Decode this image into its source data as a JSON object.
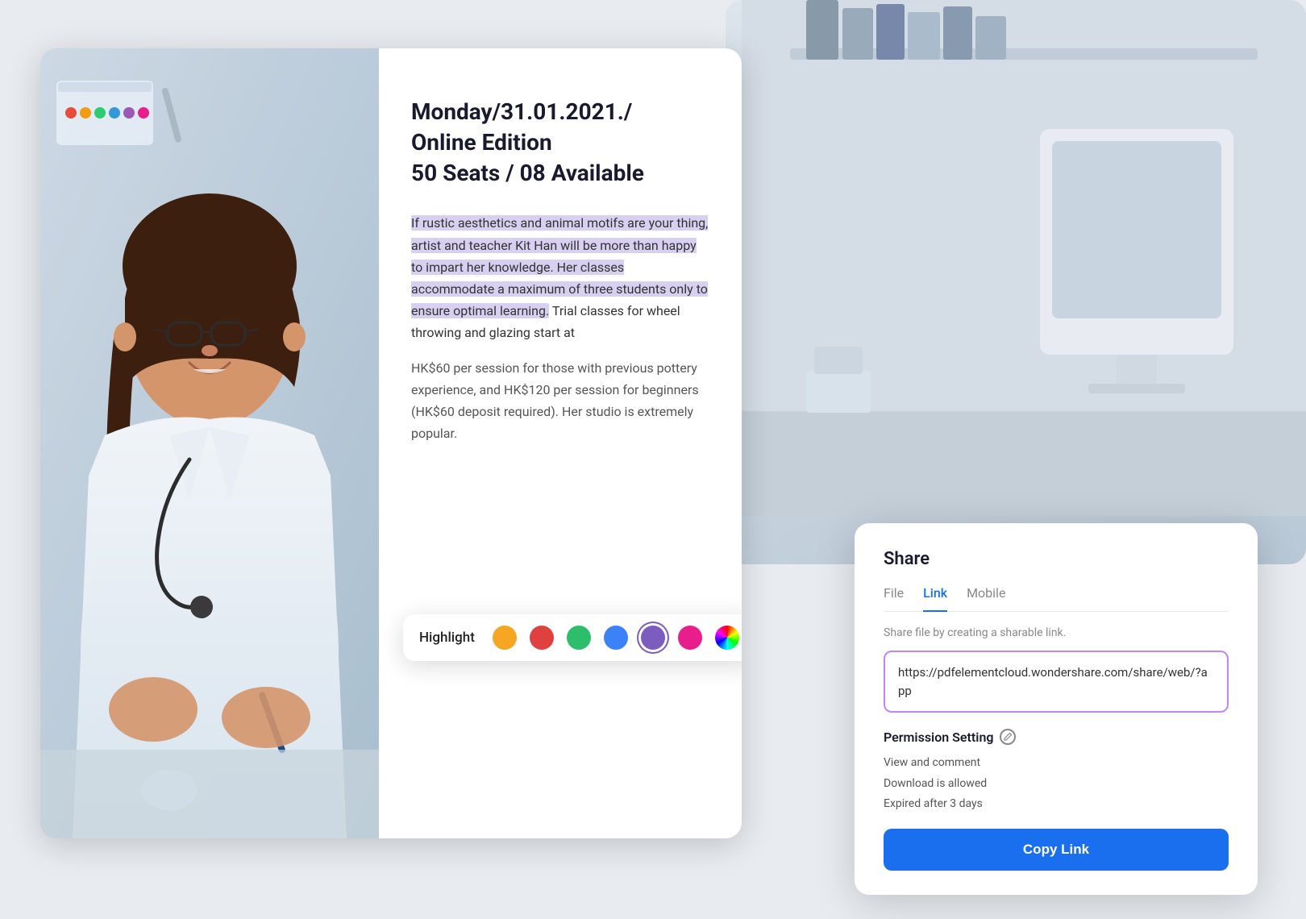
{
  "background": {
    "color": "#dce4ec"
  },
  "document": {
    "title": "Monday/31.01.2021./\nOnline Edition\n50 Seats / 08 Available",
    "body_highlighted": "If rustic aesthetics and animal motifs are your thing, artist and teacher Kit Han will be more than happy to impart her knowledge. Her classes accommodate a maximum of three students only to ensure optimal learning.",
    "body_normal": " Trial classes for wheel throwing and glazing start at",
    "price_lines": [
      "HK$60 per session for those with previous pottery",
      "experience, and HK$120 per session for beginners",
      "(HK$60 deposit required). Her studio is extremely",
      "popular."
    ]
  },
  "highlight_toolbar": {
    "label": "Highlight",
    "colors": [
      {
        "name": "yellow",
        "hex": "#f5a623",
        "selected": false
      },
      {
        "name": "red",
        "hex": "#e04040",
        "selected": false
      },
      {
        "name": "green",
        "hex": "#2dbe6c",
        "selected": false
      },
      {
        "name": "blue",
        "hex": "#3b82f6",
        "selected": false
      },
      {
        "name": "purple",
        "hex": "#7c5cbf",
        "selected": true
      },
      {
        "name": "pink",
        "hex": "#e91e8c",
        "selected": false
      },
      {
        "name": "rainbow",
        "hex": "rainbow",
        "selected": false
      }
    ]
  },
  "share_panel": {
    "title": "Share",
    "tabs": [
      {
        "label": "File",
        "active": false
      },
      {
        "label": "Link",
        "active": true
      },
      {
        "label": "Mobile",
        "active": false
      }
    ],
    "subtitle": "Share file by creating a sharable link.",
    "link_url": "https://pdfelementcloud.wondershare.com/share/web/?app",
    "permission": {
      "title": "Permission Setting",
      "items": [
        "View and comment",
        "Download is allowed",
        "Expired after 3 days"
      ]
    },
    "copy_button_label": "Copy Link"
  }
}
